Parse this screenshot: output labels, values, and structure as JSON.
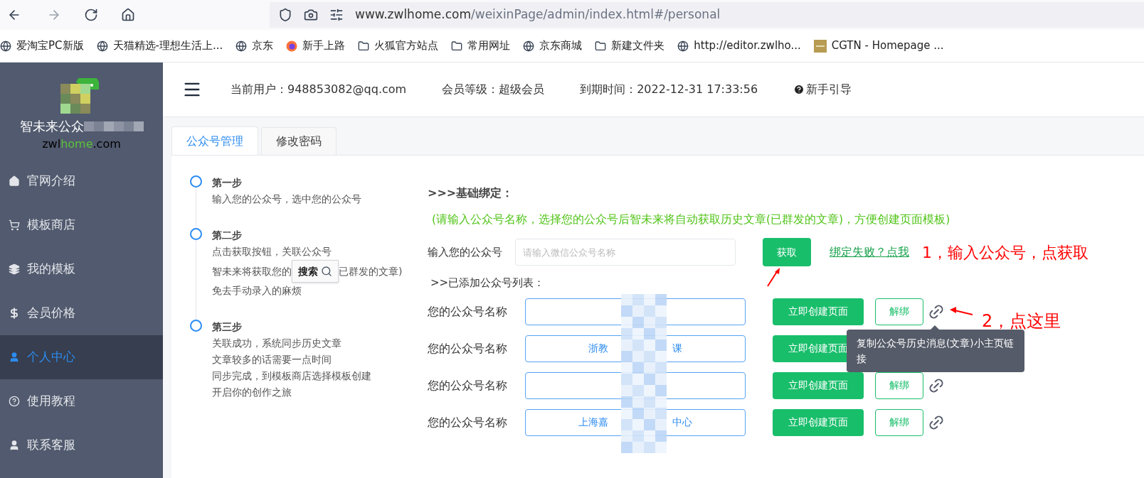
{
  "browser": {
    "url_host": "www.zwlhome.com",
    "url_path": "/weixinPage/admin/index.html#/personal",
    "bookmarks": [
      {
        "label": "爱淘宝PC新版",
        "kind": "globe"
      },
      {
        "label": "天猫精选-理想生活上...",
        "kind": "globe"
      },
      {
        "label": "京东",
        "kind": "globe"
      },
      {
        "label": "新手上路",
        "kind": "firefox"
      },
      {
        "label": "火狐官方站点",
        "kind": "folder"
      },
      {
        "label": "常用网址",
        "kind": "folder"
      },
      {
        "label": "京东商城",
        "kind": "globe"
      },
      {
        "label": "新建文件夹",
        "kind": "folder"
      },
      {
        "label": "http://editor.zwlho...",
        "kind": "globe"
      },
      {
        "label": "CGTN - Homepage ...",
        "kind": "square"
      }
    ]
  },
  "sidebar": {
    "logo_text": "智未来公众",
    "domain": [
      "zwl",
      "home",
      ".com"
    ],
    "items": [
      {
        "label": "官网介绍",
        "kind": "home",
        "selected": false
      },
      {
        "label": "模板商店",
        "kind": "cart",
        "selected": false
      },
      {
        "label": "我的模板",
        "kind": "stack",
        "selected": false
      },
      {
        "label": "会员价格",
        "kind": "dollar",
        "selected": false
      },
      {
        "label": "个人中心",
        "kind": "user",
        "selected": true
      },
      {
        "label": "使用教程",
        "kind": "help",
        "selected": false
      },
      {
        "label": "联系客服",
        "kind": "user",
        "selected": false
      }
    ]
  },
  "header": {
    "user": "当前用户：948853082@qq.com",
    "level": "会员等级：超级会员",
    "expiry": "到期时间：2022-12-31 17:33:56",
    "guide": "新手引导"
  },
  "tabs": [
    {
      "label": "公众号管理",
      "selected": true
    },
    {
      "label": "修改密码",
      "selected": false
    }
  ],
  "steps": [
    {
      "title": "第一步",
      "lines": [
        [
          "输入您的公众号，选中您的公众号"
        ]
      ]
    },
    {
      "title": "第二步",
      "popup": "搜索",
      "lines": [
        [
          "点击获取按钮，关联公众号"
        ],
        [
          "智未来将获取您的",
          "已群发的文章)"
        ],
        [
          "免去手动录入的麻烦"
        ]
      ]
    },
    {
      "title": "第三步",
      "lines": [
        [
          "关联成功，系统同步历史文章"
        ],
        [
          "文章较多的话需要一点时间"
        ],
        [
          "同步完成，到模板商店选择模板创建"
        ],
        [
          "开启你的创作之旅"
        ]
      ]
    }
  ],
  "binding": {
    "heading": ">>>基础绑定：",
    "hint": "(请输入公众号名称，选择您的公众号后智未来将自动获取历史文章(已群发的文章)，方便创建页面模板)",
    "input_label": "输入您的公众号",
    "placeholder": "请输入微信公众号名称",
    "fetch_button": "获取",
    "help_link": "绑定失败？点我",
    "list_heading": ">>已添加公众号列表："
  },
  "accounts": [
    {
      "label": "您的公众号名称",
      "create_button": "立即创建页面",
      "unbind": "解绑"
    },
    {
      "label": "您的公众号名称",
      "value_parts": [
        "浙教",
        "课"
      ],
      "create_button": "立即创建页面"
    },
    {
      "label": "您的公众号名称",
      "create_button": "立即创建页面",
      "unbind": "解绑"
    },
    {
      "label": "您的公众号名称",
      "value_parts": [
        "上海嘉",
        "中心"
      ],
      "create_button": "立即创建页面",
      "unbind": "解绑"
    }
  ],
  "tooltip": "复制公众号历史消息(文章)小主页链接",
  "annotations": [
    "1，输入公众号，点获取",
    "2，点这里"
  ]
}
